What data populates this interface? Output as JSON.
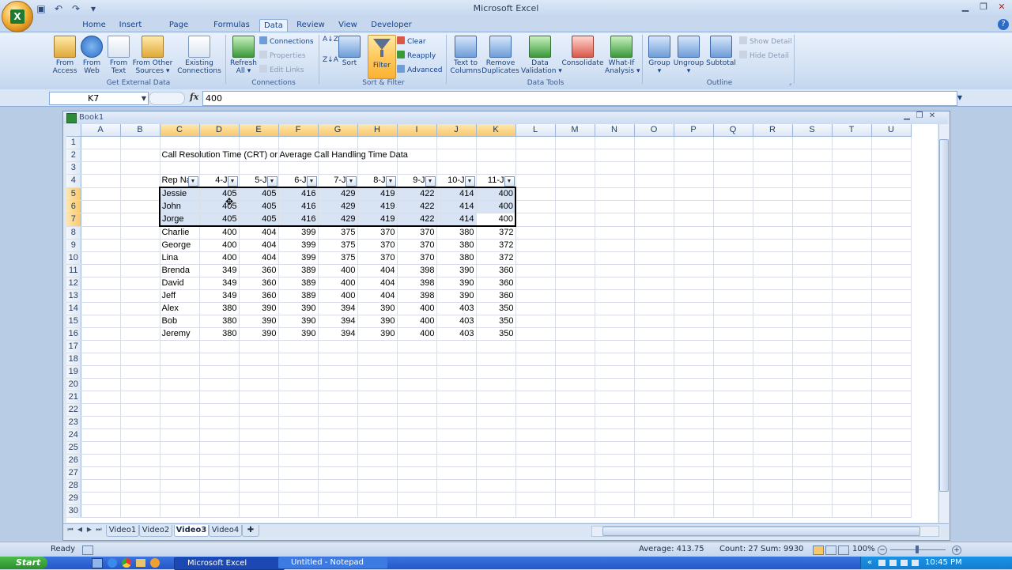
{
  "app": {
    "window_title": "Microsoft Excel",
    "logo_letter": "X"
  },
  "ribbon_tabs": [
    "Home",
    "Insert",
    "Page Layout",
    "Formulas",
    "Data",
    "Review",
    "View",
    "Developer"
  ],
  "active_tab": "Data",
  "ribbon": {
    "get_external_data": {
      "label": "Get External Data",
      "from_access": "From\nAccess",
      "from_web": "From\nWeb",
      "from_text": "From\nText",
      "from_other": "From Other\nSources ▾",
      "existing": "Existing\nConnections"
    },
    "connections": {
      "label": "Connections",
      "refresh_all": "Refresh\nAll ▾",
      "connections": "Connections",
      "properties": "Properties",
      "edit_links": "Edit Links"
    },
    "sort_filter": {
      "label": "Sort & Filter",
      "sort": "Sort",
      "filter": "Filter",
      "clear": "Clear",
      "reapply": "Reapply",
      "advanced": "Advanced"
    },
    "data_tools": {
      "label": "Data Tools",
      "text_to_columns": "Text to\nColumns",
      "remove_duplicates": "Remove\nDuplicates",
      "data_validation": "Data\nValidation ▾",
      "consolidate": "Consolidate",
      "what_if": "What-If\nAnalysis ▾"
    },
    "outline": {
      "label": "Outline",
      "group": "Group\n▾",
      "ungroup": "Ungroup\n▾",
      "subtotal": "Subtotal",
      "show_detail": "Show Detail",
      "hide_detail": "Hide Detail"
    }
  },
  "formula_bar": {
    "name_box": "K7",
    "fx": "fx",
    "value": "400"
  },
  "workbook": {
    "title": "Book1"
  },
  "columns": [
    "A",
    "B",
    "C",
    "D",
    "E",
    "F",
    "G",
    "H",
    "I",
    "J",
    "K",
    "L",
    "M",
    "N",
    "O",
    "P",
    "Q",
    "R",
    "S",
    "T",
    "U"
  ],
  "sheet": {
    "title_text": "Call Resolution Time (CRT) or Average Call Handling Time Data",
    "header_row": [
      "Rep Na",
      "4-J",
      "5-J",
      "6-J",
      "7-J",
      "8-J",
      "9-J",
      "10-J",
      "11-J"
    ],
    "rows": [
      [
        "Jessie",
        "405",
        "405",
        "416",
        "429",
        "419",
        "422",
        "414",
        "400"
      ],
      [
        "John",
        "405",
        "405",
        "416",
        "429",
        "419",
        "422",
        "414",
        "400"
      ],
      [
        "Jorge",
        "405",
        "405",
        "416",
        "429",
        "419",
        "422",
        "414",
        "400"
      ],
      [
        "Charlie",
        "400",
        "404",
        "399",
        "375",
        "370",
        "370",
        "380",
        "372"
      ],
      [
        "George",
        "400",
        "404",
        "399",
        "375",
        "370",
        "370",
        "380",
        "372"
      ],
      [
        "Lina",
        "400",
        "404",
        "399",
        "375",
        "370",
        "370",
        "380",
        "372"
      ],
      [
        "Brenda",
        "349",
        "360",
        "389",
        "400",
        "404",
        "398",
        "390",
        "360"
      ],
      [
        "David",
        "349",
        "360",
        "389",
        "400",
        "404",
        "398",
        "390",
        "360"
      ],
      [
        "Jeff",
        "349",
        "360",
        "389",
        "400",
        "404",
        "398",
        "390",
        "360"
      ],
      [
        "Alex",
        "380",
        "390",
        "390",
        "394",
        "390",
        "400",
        "403",
        "350"
      ],
      [
        "Bob",
        "380",
        "390",
        "390",
        "394",
        "390",
        "400",
        "403",
        "350"
      ],
      [
        "Jeremy",
        "380",
        "390",
        "390",
        "394",
        "390",
        "400",
        "403",
        "350"
      ]
    ],
    "row_count": 30
  },
  "sheet_tabs": [
    "Video1",
    "Video2",
    "Video3",
    "Video4"
  ],
  "active_sheet": "Video3",
  "status": {
    "mode": "Ready",
    "average": "Average: 413.75",
    "count": "Count: 27",
    "sum": "Sum: 9930",
    "zoom": "100%"
  },
  "taskbar": {
    "start": "Start",
    "task1": "Microsoft Excel",
    "task2": "Untitled - Notepad",
    "clock": "10:45 PM"
  },
  "colors": {
    "accent": "#15428b",
    "selection_header": "#f9c86c",
    "ribbon_bg": "#d1e0f3"
  }
}
